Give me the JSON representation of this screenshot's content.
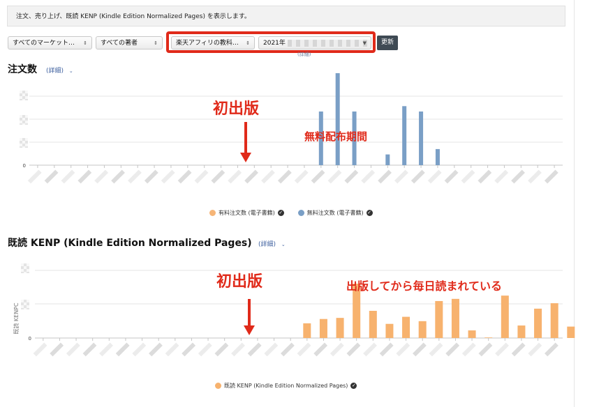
{
  "banner": {
    "text": "注文、売り上げ、既読 KENP (Kindle Edition Normalized Pages) を表示します。"
  },
  "filters": {
    "marketplace": "すべてのマーケット…",
    "author": "すべての著者",
    "book": "楽天アフィリの教科…",
    "date_prefix": "2021年",
    "update_button": "更新",
    "detail_hint": "(詳細)"
  },
  "colors": {
    "orders_bar": "#7a9fc6",
    "kenp_bar": "#f7b26e",
    "annotation": "#e02a1a",
    "highlight": "#e02a1a"
  },
  "chart_data": [
    {
      "type": "bar",
      "title": "注文数",
      "link": "(詳細)",
      "categories_count": 32,
      "y_tick_labels": [
        "0"
      ],
      "grid": true,
      "series": [
        {
          "name": "有料注文数 (電子書籍)",
          "color": "#f6b577",
          "values": [
            0,
            0,
            0,
            0,
            0,
            0,
            0,
            0,
            0,
            0,
            0,
            0,
            0,
            0,
            0,
            0,
            0,
            0,
            0,
            0,
            0,
            0,
            0,
            0,
            0,
            0,
            0,
            0,
            0,
            0,
            0,
            0
          ]
        },
        {
          "name": "無料注文数 (電子書籍)",
          "color": "#7a9fc6",
          "values": [
            0,
            0,
            0,
            0,
            0,
            0,
            0,
            0,
            0,
            0,
            0,
            0,
            0,
            0,
            0,
            0,
            0,
            1,
            3,
            1,
            0,
            0.2,
            1.1,
            1,
            0.3,
            0,
            0,
            0,
            0,
            0,
            0,
            0
          ]
        }
      ],
      "annotations": [
        "初出版",
        "無料配布期間"
      ],
      "legend_position": "bottom"
    },
    {
      "type": "bar",
      "title": "既読 KENP (Kindle Edition Normalized Pages)",
      "link": "(詳細)",
      "ylabel": "既読 KENPC",
      "categories_count": 32,
      "y_tick_labels": [
        "0"
      ],
      "grid": true,
      "series": [
        {
          "name": "既読 KENP (Kindle Edition Normalized Pages)",
          "color": "#f7b26e",
          "values": [
            0,
            0,
            0,
            0,
            0,
            0,
            0,
            0,
            0,
            0,
            0,
            0,
            0,
            0,
            0,
            0,
            0.27,
            0.35,
            0.37,
            1,
            0.5,
            0.26,
            0.39,
            0.31,
            0.68,
            0.72,
            0.14,
            0.01,
            0.78,
            0.23,
            0.54,
            0.64,
            0.21
          ]
        }
      ],
      "annotations": [
        "初出版",
        "出版してから毎日読まれている"
      ],
      "legend_position": "bottom"
    }
  ]
}
